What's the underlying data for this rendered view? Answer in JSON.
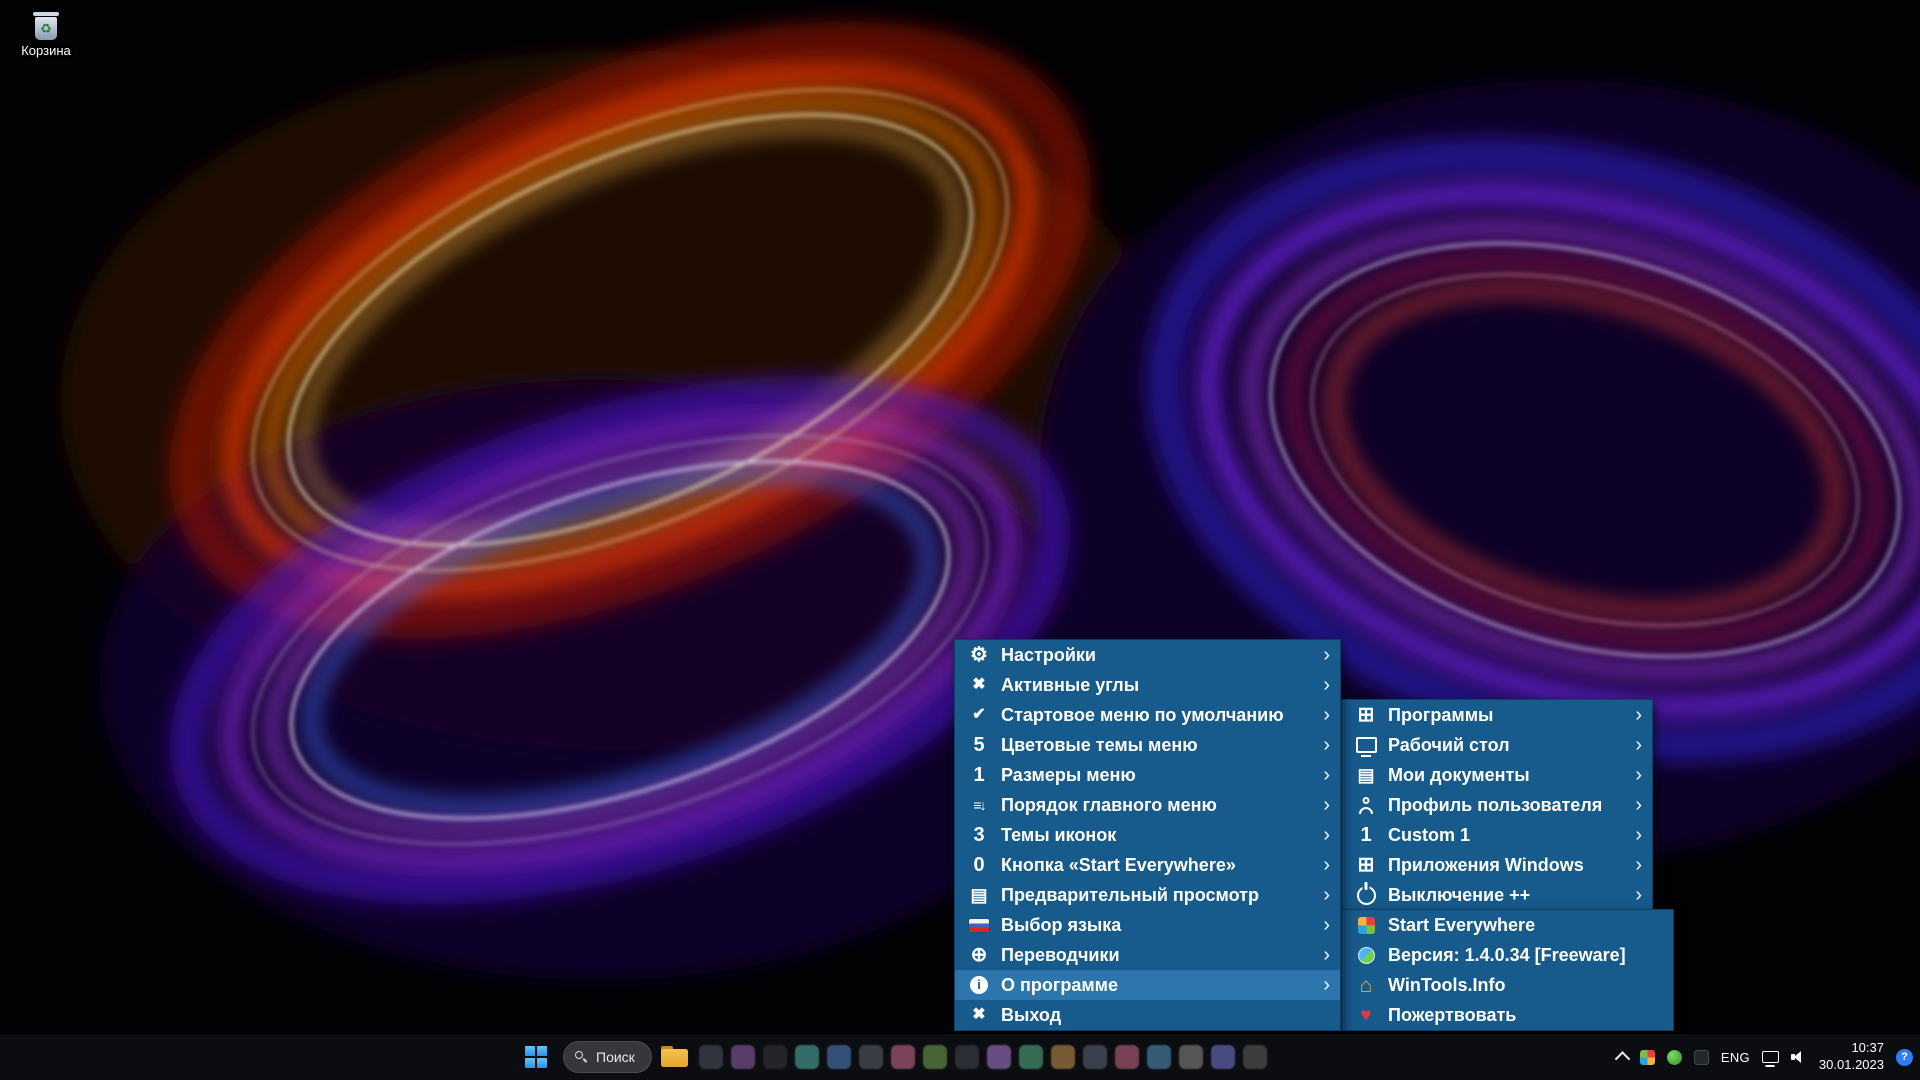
{
  "colors": {
    "menu_bg": "#175a8c",
    "menu_highlight": "#2d76ad",
    "taskbar_bg": "#0d0e12",
    "help_badge": "#2f7df6"
  },
  "desktop": {
    "recycle_bin_label": "Корзина",
    "recycle_glyph": "♻"
  },
  "menus": {
    "arrow": "›",
    "main": {
      "items": [
        {
          "label": "Настройки",
          "glyph": "⚙"
        },
        {
          "label": "Активные углы",
          "glyph": "✖"
        },
        {
          "label": "Стартовое меню по умолчанию",
          "glyph": "✔"
        },
        {
          "label": "Цветовые темы меню",
          "glyph": "5"
        },
        {
          "label": "Размеры меню",
          "glyph": "1"
        },
        {
          "label": "Порядок главного меню",
          "glyph": "≡↓"
        },
        {
          "label": "Темы иконок",
          "glyph": "3"
        },
        {
          "label": "Кнопка «Start Everywhere»",
          "glyph": "0"
        },
        {
          "label": "Предварительный просмотр",
          "glyph": "▤"
        },
        {
          "label": "Выбор языка",
          "glyph": ""
        },
        {
          "label": "Переводчики",
          "glyph": "⊕"
        },
        {
          "label": "О программе",
          "glyph": "i",
          "highlighted": true
        },
        {
          "label": "Выход",
          "glyph": "✖"
        }
      ]
    },
    "places": {
      "items": [
        {
          "label": "Программы",
          "glyph": "⊞"
        },
        {
          "label": "Рабочий стол",
          "glyph": ""
        },
        {
          "label": "Мои документы",
          "glyph": "▤"
        },
        {
          "label": "Профиль пользователя",
          "glyph": ""
        },
        {
          "label": "Custom 1",
          "glyph": "1"
        },
        {
          "label": "Приложения Windows",
          "glyph": "⊞"
        },
        {
          "label": "Выключение ++",
          "glyph": ""
        }
      ]
    },
    "about": {
      "items": [
        {
          "label": "Start Everywhere",
          "glyph": ""
        },
        {
          "label": "Версия: 1.4.0.34 [Freeware]",
          "glyph": ""
        },
        {
          "label": "WinTools.Info",
          "glyph": "⌂"
        },
        {
          "label": "Пожертвовать",
          "glyph": "♥"
        }
      ]
    }
  },
  "taskbar": {
    "search_label": "Поиск",
    "language": "ENG",
    "time": "10:37",
    "date": "30.01.2023",
    "help_badge": "?"
  }
}
